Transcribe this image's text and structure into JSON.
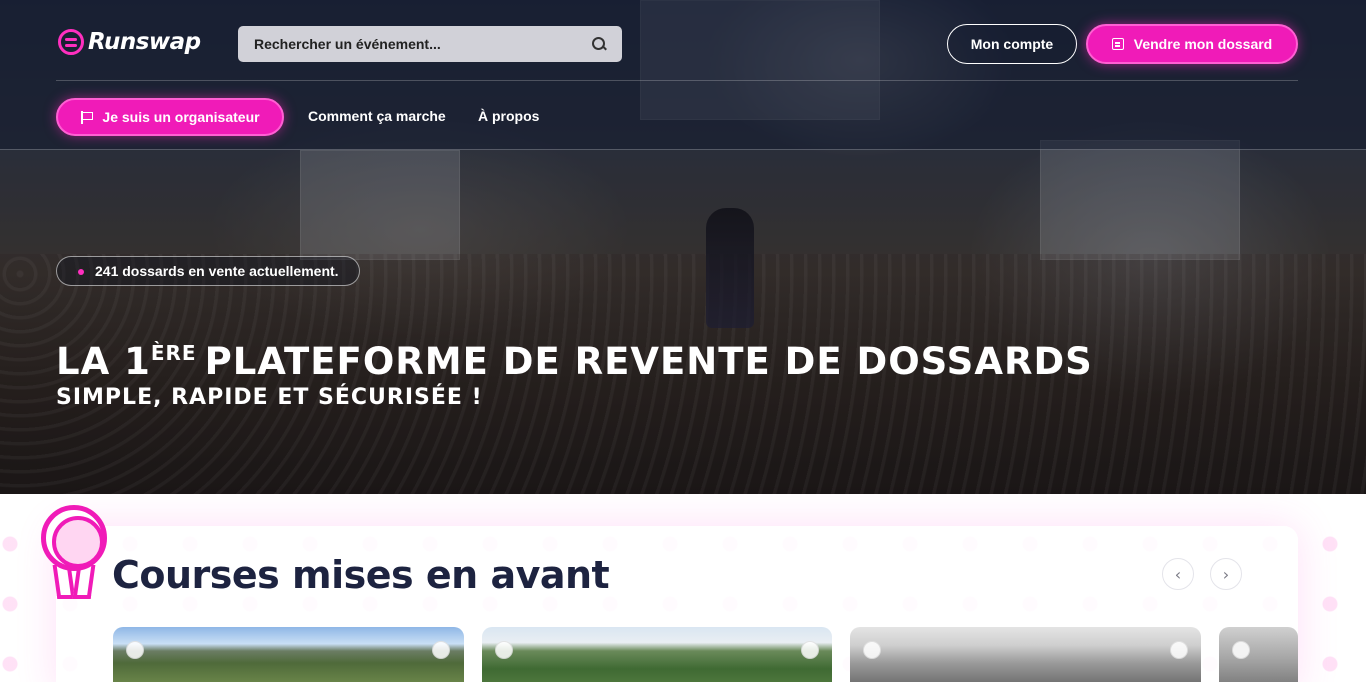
{
  "header": {
    "logo_text": "Runswap",
    "search_placeholder": "Rechercher un événement...",
    "account_label": "Mon compte",
    "sell_label": "Vendre mon dossard",
    "organizer_label": "Je suis un organisateur",
    "nav": [
      "Comment ça marche",
      "À propos"
    ]
  },
  "hero": {
    "badge_text": "241 dossards en vente actuellement.",
    "title_prefix": "LA 1",
    "title_sup": "ÈRE",
    "title_rest": "PLATEFORME DE REVENTE DE DOSSARDS",
    "subtitle": "SIMPLE, RAPIDE ET SÉCURISÉE !"
  },
  "featured": {
    "title": "Courses mises en avant",
    "prev_icon": "‹",
    "next_icon": "›"
  },
  "colors": {
    "accent": "#f01bb8",
    "heading": "#1d2340"
  }
}
